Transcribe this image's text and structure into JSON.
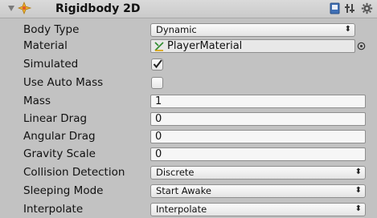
{
  "component": {
    "title": "Rigidbody 2D",
    "icons": {
      "foldout": "foldout-arrow-icon",
      "component": "rigidbody2d-icon",
      "help": "help-book-icon",
      "settings": "gear-icon",
      "layout": "preset-icon"
    }
  },
  "rows": {
    "body_type": {
      "label": "Body Type",
      "value": "Dynamic"
    },
    "material": {
      "label": "Material",
      "value": "PlayerMaterial"
    },
    "simulated": {
      "label": "Simulated",
      "checked": true
    },
    "use_auto_mass": {
      "label": "Use Auto Mass",
      "checked": false
    },
    "mass": {
      "label": "Mass",
      "value": "1"
    },
    "linear_drag": {
      "label": "Linear Drag",
      "value": "0"
    },
    "angular_drag": {
      "label": "Angular Drag",
      "value": "0"
    },
    "gravity_scale": {
      "label": "Gravity Scale",
      "value": "0"
    },
    "collision_detection": {
      "label": "Collision Detection",
      "value": "Discrete"
    },
    "sleeping_mode": {
      "label": "Sleeping Mode",
      "value": "Start Awake"
    },
    "interpolate": {
      "label": "Interpolate",
      "value": "Interpolate"
    }
  },
  "glyphs": {
    "popup_arrows": "⬍",
    "picker": "⊙"
  }
}
